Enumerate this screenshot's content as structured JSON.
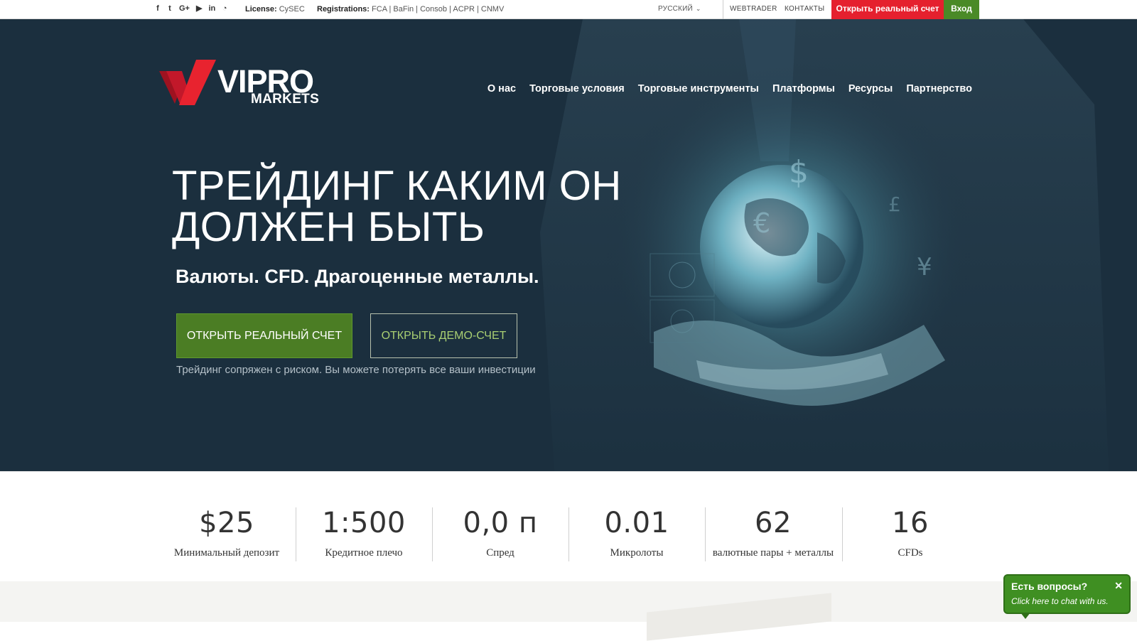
{
  "topbar": {
    "social_icons": [
      {
        "name": "facebook-icon",
        "glyph": "f"
      },
      {
        "name": "twitter-icon",
        "glyph": "t"
      },
      {
        "name": "google-plus-icon",
        "glyph": "G+"
      },
      {
        "name": "youtube-icon",
        "glyph": "▶"
      },
      {
        "name": "linkedin-icon",
        "glyph": "in"
      },
      {
        "name": "rss-icon",
        "glyph": "◔"
      }
    ],
    "license_label": "License:",
    "license_value": "CySEC",
    "registrations_label": "Registrations:",
    "registrations_value": "FCA | BaFin | Consob | ACPR | CNMV",
    "language": "РУССКИЙ",
    "webtrader": "WEBTRADER",
    "contacts": "КОНТАКТЫ",
    "open_account": "Открыть реальный счет",
    "login": "Вход"
  },
  "logo": {
    "line1": "VIPRO",
    "line2": "MARKETS"
  },
  "nav": [
    "О нас",
    "Торговые условия",
    "Торговые инструменты",
    "Платформы",
    "Ресурсы",
    "Партнерство"
  ],
  "hero": {
    "headline_line1": "ТРЕЙДИНГ КАКИМ ОН",
    "headline_line2": "ДОЛЖЕН БЫТЬ",
    "subhead": "Валюты. CFD. Драгоценные металлы.",
    "btn_real": "ОТКРЫТЬ РЕАЛЬНЫЙ СЧЕТ",
    "btn_demo": "ОТКРЫТЬ ДЕМО-СЧЕТ",
    "risk": "Трейдинг сопряжен с риском. Вы можете потерять все ваши инвестиции"
  },
  "stats": [
    {
      "value": "$25",
      "label": "Минимальный депозит"
    },
    {
      "value": "1:500",
      "label": "Кредитное плечо"
    },
    {
      "value": "0,0 п",
      "label": "Спред"
    },
    {
      "value": "0.01",
      "label": "Микролоты"
    },
    {
      "value": "62",
      "label": "валютные пары + металлы"
    },
    {
      "value": "16",
      "label": "CFDs"
    }
  ],
  "chat": {
    "title": "Есть вопросы?",
    "subtitle": "Click here to chat with us.",
    "close": "✕"
  },
  "colors": {
    "hero_bg": "#1b2f3e",
    "brand_red": "#e5202e",
    "brand_green": "#4a8a27",
    "demo_text": "#a9cf72"
  }
}
